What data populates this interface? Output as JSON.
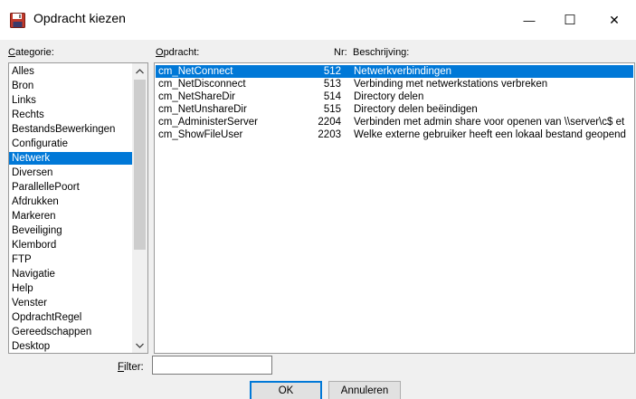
{
  "window": {
    "title": "Opdracht kiezen",
    "minimize_glyph": "—",
    "maximize_glyph": "☐",
    "close_glyph": "✕"
  },
  "headers": {
    "category_prefix": "C",
    "category_rest": "ategorie:",
    "command_prefix": "O",
    "command_rest": "pdracht:",
    "nr": "Nr:",
    "description": "Beschrijving:"
  },
  "categories": {
    "selected": "Netwerk",
    "items": [
      "Alles",
      "Bron",
      "Links",
      "Rechts",
      "BestandsBewerkingen",
      "Configuratie",
      "Netwerk",
      "Diversen",
      "ParallellePoort",
      "Afdrukken",
      "Markeren",
      "Beveiliging",
      "Klembord",
      "FTP",
      "Navigatie",
      "Help",
      "Venster",
      "OpdrachtRegel",
      "Gereedschappen",
      "Desktop"
    ]
  },
  "commands": [
    {
      "name": "cm_NetConnect",
      "nr": "512",
      "desc": "Netwerkverbindingen",
      "selected": true
    },
    {
      "name": "cm_NetDisconnect",
      "nr": "513",
      "desc": "Verbinding met netwerkstations verbreken",
      "selected": false
    },
    {
      "name": "cm_NetShareDir",
      "nr": "514",
      "desc": "Directory delen",
      "selected": false
    },
    {
      "name": "cm_NetUnshareDir",
      "nr": "515",
      "desc": "Directory delen beëindigen",
      "selected": false
    },
    {
      "name": "cm_AdministerServer",
      "nr": "2204",
      "desc": "Verbinden met admin share voor openen van \\\\server\\c$ et",
      "selected": false
    },
    {
      "name": "cm_ShowFileUser",
      "nr": "2203",
      "desc": "Welke externe gebruiker heeft een lokaal bestand geopend",
      "selected": false
    }
  ],
  "filter": {
    "label_prefix": "F",
    "label_rest": "ilter:",
    "value": ""
  },
  "buttons": {
    "ok": "OK",
    "cancel": "Annuleren"
  },
  "colors": {
    "selection": "#0078d7",
    "dialog_bg": "#f0f0f0"
  }
}
